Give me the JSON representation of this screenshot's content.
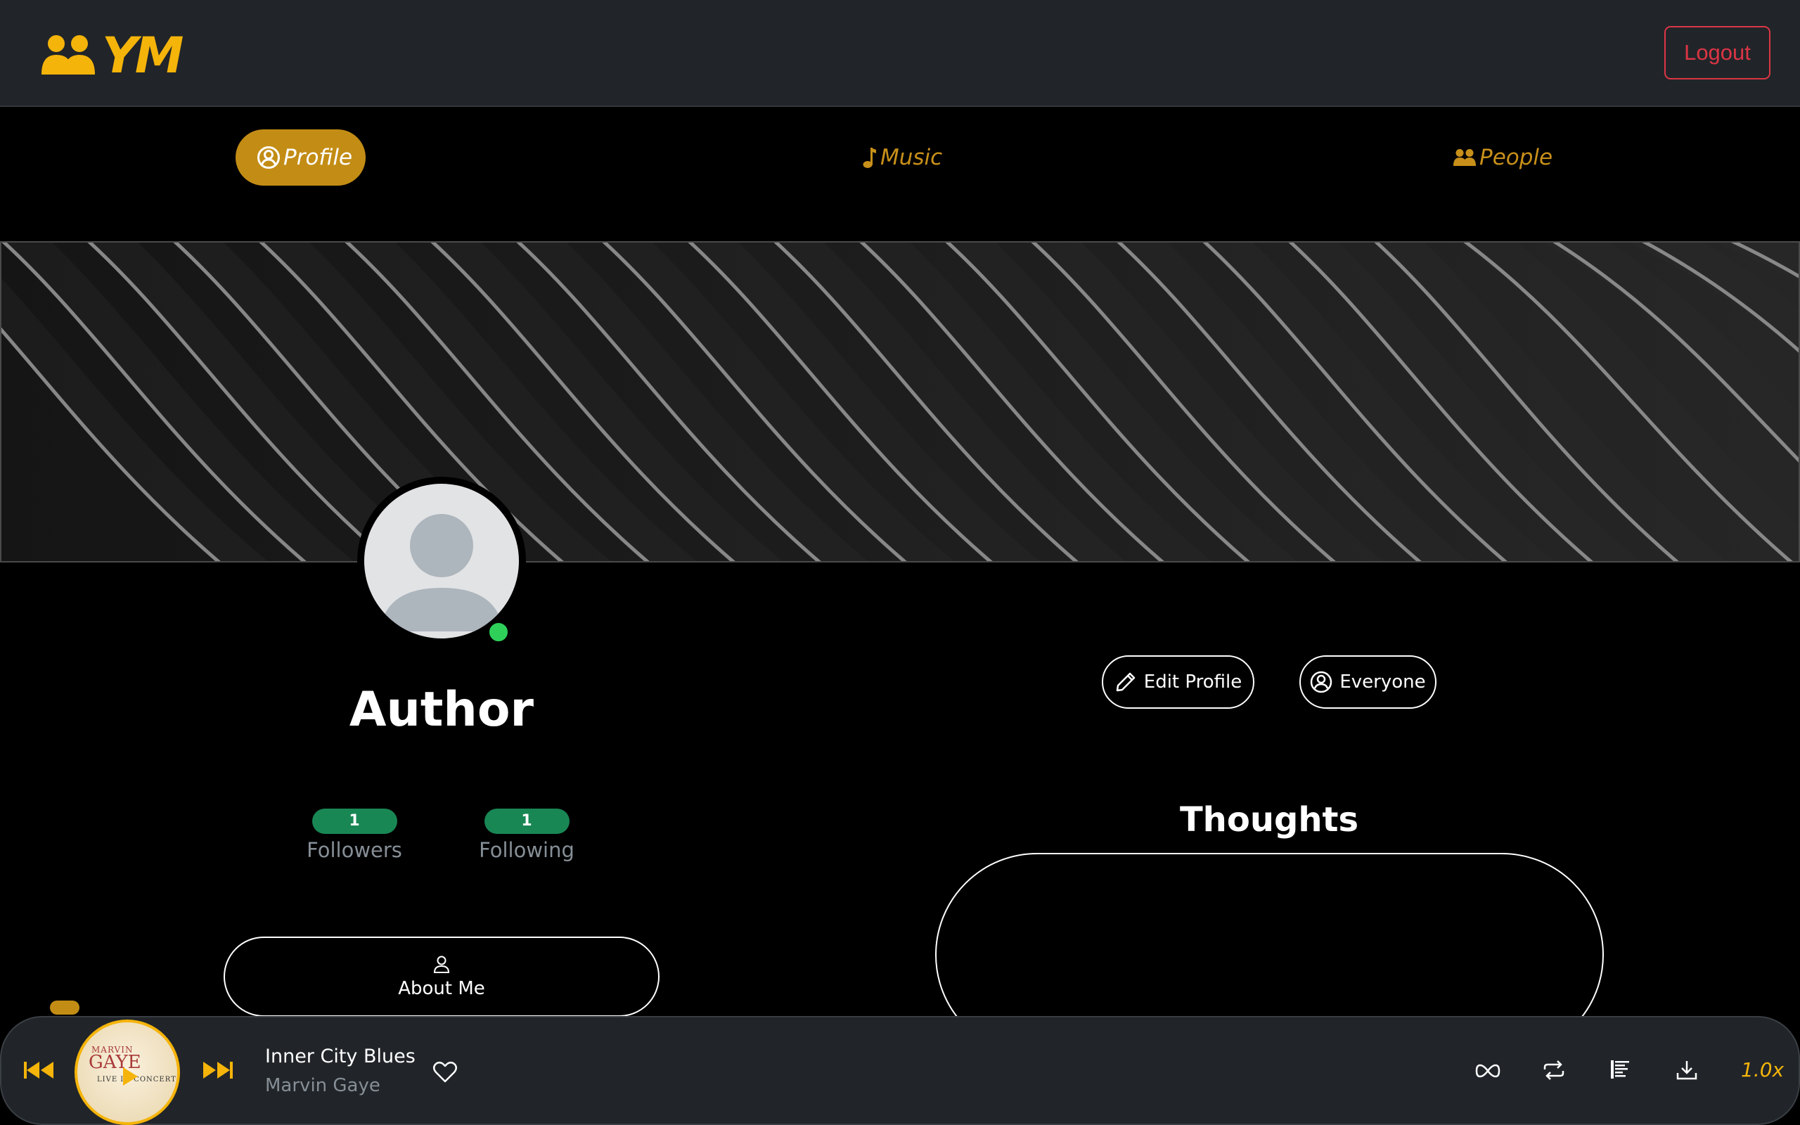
{
  "header": {
    "logo_text": "YM",
    "logo_icon": "people-icon",
    "logout_label": "Logout"
  },
  "nav": {
    "tabs": [
      {
        "label": "Profile",
        "icon": "person-circle-icon",
        "active": true
      },
      {
        "label": "Music",
        "icon": "music-note-icon",
        "active": false
      },
      {
        "label": "People",
        "icon": "people-icon",
        "active": false
      }
    ]
  },
  "profile": {
    "name": "Author",
    "online": true,
    "followers": {
      "count": "1",
      "label": "Followers"
    },
    "following": {
      "count": "1",
      "label": "Following"
    },
    "about_label": "About Me",
    "edit_label": "Edit Profile",
    "visibility_label": "Everyone"
  },
  "thoughts": {
    "title": "Thoughts"
  },
  "player": {
    "song_title": "Inner City Blues",
    "artist": "Marvin Gaye",
    "album_art_text": [
      "MARVIN",
      "GAYE",
      "LIVE IN CONCERT"
    ],
    "speed": "1.0x"
  },
  "colors": {
    "accent": "#f5b40a",
    "tab_active_bg": "#c38d15",
    "danger": "#dc3545",
    "badge": "#198754",
    "online": "#2fd05a",
    "surface": "#212529"
  }
}
